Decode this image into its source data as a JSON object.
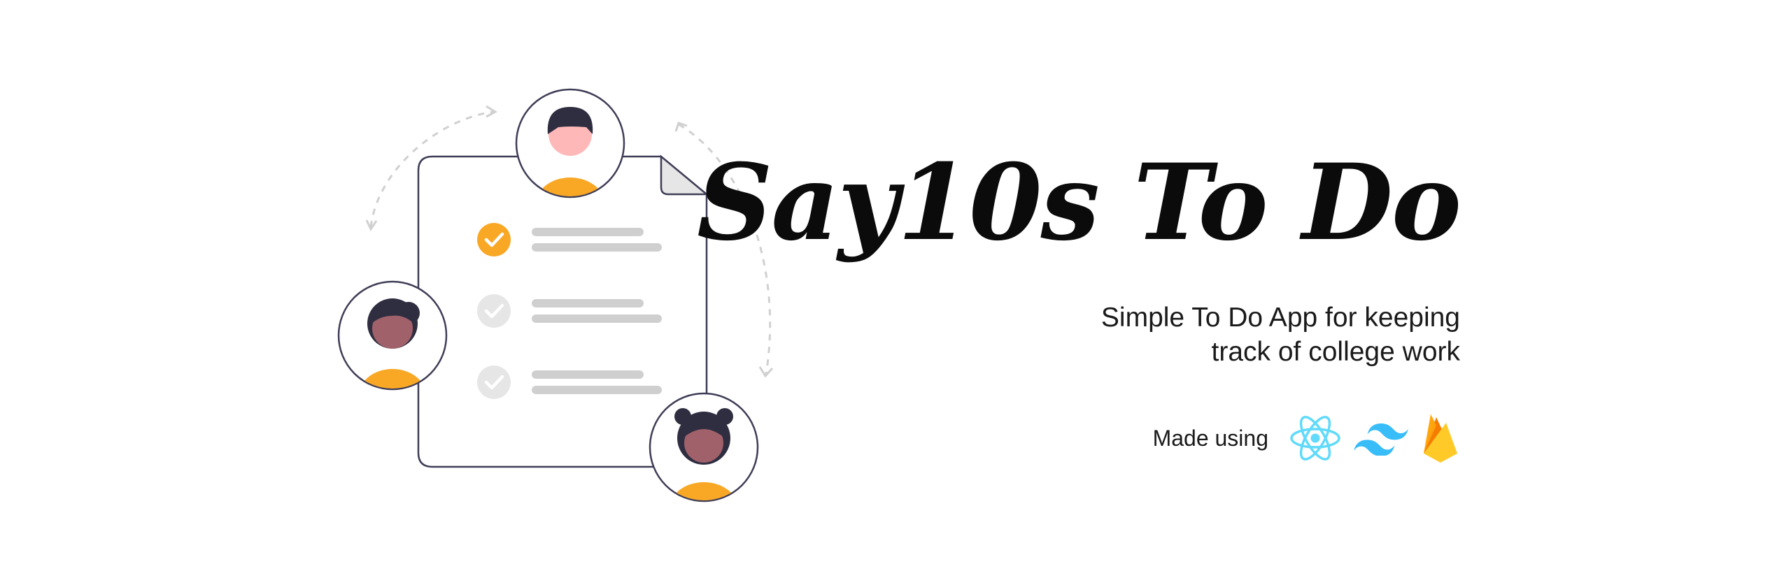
{
  "header": {
    "title": "Say10s To Do",
    "subtitle_line1": "Simple To Do App for keeping",
    "subtitle_line2": "track of college work"
  },
  "tech": {
    "label": "Made using",
    "icons": [
      "react-icon",
      "tailwind-icon",
      "firebase-icon"
    ]
  },
  "illustration": {
    "checklist_items": [
      {
        "checked": true
      },
      {
        "checked": false
      },
      {
        "checked": false
      }
    ],
    "avatars": 3
  },
  "colors": {
    "accent": "#F9A826",
    "react": "#61DAFB",
    "tailwind": "#38BDF8",
    "text": "#0b0b0b",
    "line_gray": "#cfcfcf",
    "check_gray": "#e6e6e6",
    "avatar_hair": "#2f2e41",
    "avatar_skin_dark": "#a0616a",
    "avatar_skin_light": "#ffb8b8"
  }
}
